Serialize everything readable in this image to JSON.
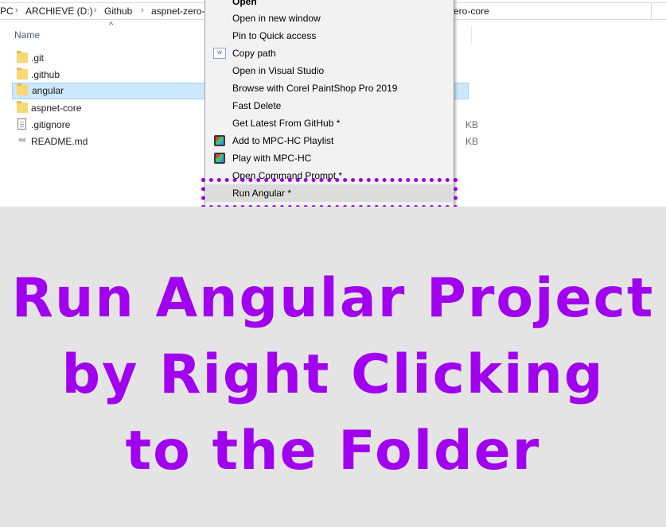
{
  "breadcrumb": {
    "items": [
      "PC",
      "ARCHIEVE (D:)",
      "Github",
      "aspnet-zero-",
      "zero-core"
    ]
  },
  "columns": {
    "name": "Name"
  },
  "files": [
    {
      "name": ".git",
      "type": "folder",
      "size": ""
    },
    {
      "name": ".github",
      "type": "folder",
      "size": ""
    },
    {
      "name": "angular",
      "type": "folder",
      "size": "",
      "selected": true
    },
    {
      "name": "aspnet-core",
      "type": "folder",
      "size": ""
    },
    {
      "name": ".gitignore",
      "type": "file",
      "size": "KB"
    },
    {
      "name": "README.md",
      "type": "file",
      "size": "KB"
    }
  ],
  "context_menu": {
    "items": [
      {
        "label": "Open",
        "bold": true,
        "icon": ""
      },
      {
        "label": "Open in new window",
        "icon": ""
      },
      {
        "label": "Pin to Quick access",
        "icon": ""
      },
      {
        "label": "Copy path",
        "icon": "vs-icon"
      },
      {
        "label": "Open in Visual Studio",
        "icon": ""
      },
      {
        "label": "Browse with Corel PaintShop Pro 2019",
        "icon": ""
      },
      {
        "label": "Fast Delete",
        "icon": ""
      },
      {
        "label": "Get Latest From GitHub *",
        "icon": ""
      },
      {
        "label": "Add to MPC-HC Playlist",
        "icon": "mpc-hc-icon"
      },
      {
        "label": "Play with MPC-HC",
        "icon": "mpc-hc-icon"
      },
      {
        "label": "Open Command Prompt *",
        "icon": ""
      },
      {
        "label": "Run Angular *",
        "icon": "",
        "highlighted": true
      }
    ]
  },
  "caption": {
    "line1": "Run Angular Project",
    "line2": "by Right Clicking",
    "line3": "to the Folder"
  },
  "colors": {
    "caption": "#a100ef",
    "highlight_border": "#9a00e0",
    "caption_bg": "#e4e4e4",
    "selection": "#cce8ff"
  }
}
